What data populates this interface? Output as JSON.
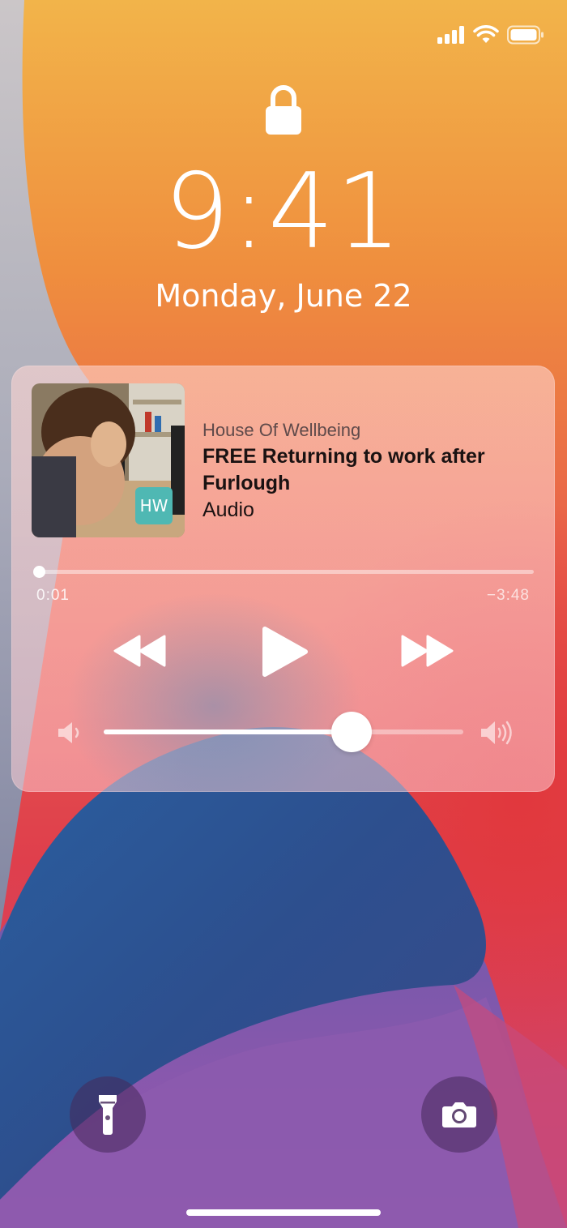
{
  "lockscreen": {
    "time": "9:41",
    "date": "Monday, June 22"
  },
  "status_bar": {
    "signal_icon": "cellular-signal-icon",
    "wifi_icon": "wifi-icon",
    "battery_icon": "battery-icon"
  },
  "now_playing": {
    "source": "House Of Wellbeing",
    "title": "FREE Returning to work after Furlough",
    "subtitle": "Audio",
    "app_badge": "HW",
    "elapsed": "0:01",
    "remaining": "−3:48",
    "progress_fraction": 0.002,
    "volume_fraction": 0.69,
    "controls": {
      "rewind_icon": "rewind-icon",
      "play_icon": "play-icon",
      "forward_icon": "fast-forward-icon",
      "volume_low_icon": "speaker-low-icon",
      "volume_high_icon": "speaker-high-icon"
    }
  },
  "quick_actions": {
    "left_icon": "flashlight-icon",
    "right_icon": "camera-icon"
  },
  "colors": {
    "wallpaper_top": "#f2b44a",
    "wallpaper_mid": "#e8604a",
    "wallpaper_blue": "#2c5a9a",
    "badge_teal": "#4fb8b3"
  }
}
